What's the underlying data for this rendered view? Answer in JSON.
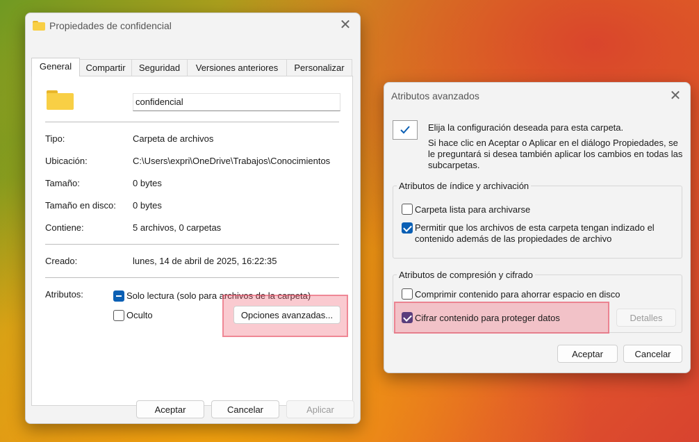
{
  "props_dialog": {
    "title": "Propiedades de confidencial",
    "tabs": [
      {
        "label": "General"
      },
      {
        "label": "Compartir"
      },
      {
        "label": "Seguridad"
      },
      {
        "label": "Versiones anteriores"
      },
      {
        "label": "Personalizar"
      }
    ],
    "folder_name": "confidencial",
    "fields": {
      "tipo": {
        "label": "Tipo:",
        "value": "Carpeta de archivos"
      },
      "ubicacion": {
        "label": "Ubicación:",
        "value": "C:\\Users\\expri\\OneDrive\\Trabajos\\Conocimientos"
      },
      "tamano": {
        "label": "Tamaño:",
        "value": "0 bytes"
      },
      "tamano_disco": {
        "label": "Tamaño en disco:",
        "value": "0 bytes"
      },
      "contiene": {
        "label": "Contiene:",
        "value": "5 archivos, 0 carpetas"
      },
      "creado": {
        "label": "Creado:",
        "value": "lunes, 14 de abril de 2025, 16:22:35"
      }
    },
    "attributes": {
      "label": "Atributos:",
      "readonly_label": "Solo lectura (solo para archivos de la carpeta)",
      "hidden_label": "Oculto",
      "advanced_button": "Opciones avanzadas..."
    },
    "buttons": {
      "ok": "Aceptar",
      "cancel": "Cancelar",
      "apply": "Aplicar"
    }
  },
  "advanced_dialog": {
    "title": "Atributos avanzados",
    "intro": "Elija la configuración deseada para esta carpeta.",
    "info": "Si hace clic en Aceptar o Aplicar en el diálogo Propiedades, se le preguntará si desea también aplicar los cambios en todas las subcarpetas.",
    "index_group": {
      "title": "Atributos de índice y archivación",
      "archive_label": "Carpeta lista para archivarse",
      "index_label": "Permitir que los archivos de esta carpeta tengan indizado el contenido además de las propiedades de archivo"
    },
    "compress_group": {
      "title": "Atributos de compresión y cifrado",
      "compress_label": "Comprimir contenido para ahorrar espacio en disco",
      "encrypt_label": "Cifrar contenido para proteger datos",
      "details_button": "Detalles"
    },
    "buttons": {
      "ok": "Aceptar",
      "cancel": "Cancelar"
    }
  },
  "colors": {
    "accent": "#0a5fb4",
    "encrypt_check": "#5a3e7c",
    "highlight": "#f05a6e"
  }
}
